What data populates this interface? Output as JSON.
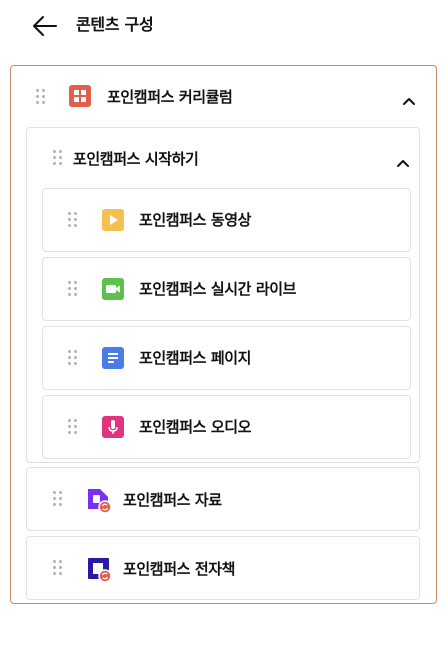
{
  "header": {
    "title": "콘텐츠 구성",
    "back_icon": "arrow-left-icon"
  },
  "curriculum": {
    "title": "포인캠퍼스 커리큘럼",
    "icon": "grid-icon",
    "icon_color": "#e0614a",
    "border_color": "#c98a66",
    "expanded": true,
    "section": {
      "title": "포인캠퍼스 시작하기",
      "expanded": true,
      "lessons": [
        {
          "label": "포인캠퍼스 동영상",
          "icon": "play-icon",
          "color": "#f5c04f"
        },
        {
          "label": "포인캠퍼스 실시간 라이브",
          "icon": "video-camera-icon",
          "color": "#5ec14c"
        },
        {
          "label": "포인캠퍼스 페이지",
          "icon": "document-icon",
          "color": "#4a7ce8"
        },
        {
          "label": "포인캠퍼스 오디오",
          "icon": "microphone-icon",
          "color": "#e2337f"
        }
      ]
    },
    "items": [
      {
        "label": "포인캠퍼스 자료",
        "icon": "file-sync-icon",
        "color": "#7b2ff0"
      },
      {
        "label": "포인캠퍼스 전자책",
        "icon": "ebook-sync-icon",
        "color": "#2a18a6"
      }
    ]
  }
}
